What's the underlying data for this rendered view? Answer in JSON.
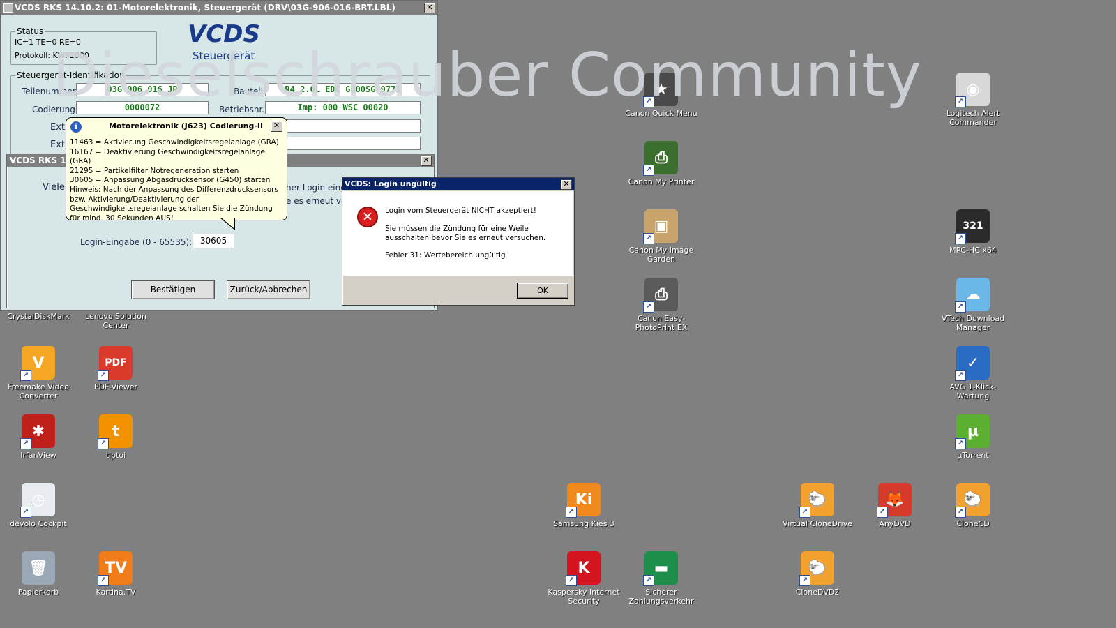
{
  "watermark": "Dieselschrauber Community",
  "main_window": {
    "title": "VCDS RKS 14.10.2: 01-Motorelektronik,  Steuergerät (DRV\\03G-906-016-BRT.LBL)",
    "logo": "VCDS",
    "logo_sub": "Steuergerät",
    "status": {
      "legend": "Status",
      "line1": "IC=1  TE=0   RE=0",
      "line2": "Protokoll: KWP2000"
    },
    "ident": {
      "legend": "Steuergerät-Identifikation",
      "teilenummer_label": "Teilenummer:",
      "teilenummer_value": "03G 906 016 JP",
      "bauteil_label": "Bauteil:",
      "bauteil_value": "R4 2.0L EDC G000SG  9771",
      "codierung_label": "Codierung:",
      "codierung_value": "0000072",
      "betriebsnr_label": "Betriebsnr.:",
      "betriebsnr_value": "Imp: 000     WSC 00020",
      "ext1_label": "Ext",
      "ext2_label": "Ext"
    }
  },
  "sub_window": {
    "title": "VCDS RKS 14.1",
    "text_left": "Viele",
    "text_right1": "her Login eing",
    "text_right2": "e es erneut ve",
    "login_label": "Login-Eingabe (0 - 65535):",
    "login_value": "30605",
    "confirm_button": "Bestätigen",
    "back_button": "Zurück/Abbrechen"
  },
  "tooltip": {
    "title": "Motorelektronik (J623) Codierung-II",
    "lines": [
      "11463 = Aktivierung Geschwindigkeitsregelanlage (GRA)",
      "16167 = Deaktivierung Geschwindigkeitsregelanlage (GRA)",
      "21295 = Partikelfilter Notregeneration starten",
      "30605 = Anpassung Abgasdrucksensor (G450) starten"
    ],
    "hint": "Hinweis: Nach der Anpassung des Differenzdrucksensors bzw. Aktivierung/Deaktivierung der Geschwindigkeitsregelanlage schalten Sie die Zündung für mind. 30 Sekunden AUS!"
  },
  "error_dialog": {
    "title": "VCDS: Login ungültig",
    "line1": "Login vom Steuergerät NICHT akzeptiert!",
    "line2": "Sie müssen die Zündung für eine Weile ausschalten bevor Sie es erneut versuchen.",
    "line3": "Fehler 31: Wertebereich ungültig",
    "ok_button": "OK"
  },
  "desktop_icons": [
    {
      "label": "CrystalDiskMark",
      "glyph": "",
      "color": "#808080"
    },
    {
      "label": "Lenovo Solution Center",
      "glyph": "",
      "color": "#808080"
    },
    {
      "label": "Freemake Video Converter",
      "glyph": "V",
      "color": "#f5a623"
    },
    {
      "label": "PDF-Viewer",
      "glyph": "PDF",
      "color": "#d93a2b"
    },
    {
      "label": "IrfanView",
      "glyph": "✱",
      "color": "#c0201a"
    },
    {
      "label": "tiptoi",
      "glyph": "t",
      "color": "#f39200"
    },
    {
      "label": "devolo Cockpit",
      "glyph": "◷",
      "color": "#e8ecf0"
    },
    {
      "label": "Papierkorb",
      "glyph": "🗑",
      "color": "#9aa7b4"
    },
    {
      "label": "Kartina.TV",
      "glyph": "TV",
      "color": "#f07d1a"
    },
    {
      "label": "Canon Quick Menu",
      "glyph": "★",
      "color": "#4a4a4a"
    },
    {
      "label": "Canon My Printer",
      "glyph": "⎙",
      "color": "#3b6e2f"
    },
    {
      "label": "Canon My Image Garden",
      "glyph": "▣",
      "color": "#c9a46a"
    },
    {
      "label": "Canon Easy-PhotoPrint EX",
      "glyph": "⎙",
      "color": "#5a5a5a"
    },
    {
      "label": "Samsung Kies 3",
      "glyph": "Ki",
      "color": "#f08a1c"
    },
    {
      "label": "Kaspersky Internet Security",
      "glyph": "K",
      "color": "#d4141f"
    },
    {
      "label": "Sicherer Zahlungsverkehr",
      "glyph": "▬",
      "color": "#1e8f4a"
    },
    {
      "label": "Virtual CloneDrive",
      "glyph": "🐑",
      "color": "#f2a02e"
    },
    {
      "label": "AnyDVD",
      "glyph": "🦊",
      "color": "#d63a2a"
    },
    {
      "label": "CloneCD",
      "glyph": "🐑",
      "color": "#f2a02e"
    },
    {
      "label": "CloneDVD2",
      "glyph": "🐑",
      "color": "#f2a02e"
    },
    {
      "label": "Logitech Alert Commander",
      "glyph": "◉",
      "color": "#d8d8d8"
    },
    {
      "label": "MPC-HC x64",
      "glyph": "321",
      "color": "#2b2b2b"
    },
    {
      "label": "VTech Download Manager",
      "glyph": "☁",
      "color": "#6ab7e8"
    },
    {
      "label": "AVG 1-Klick-Wartung",
      "glyph": "✓",
      "color": "#2a6bc4"
    },
    {
      "label": "µTorrent",
      "glyph": "µ",
      "color": "#5cb030"
    }
  ]
}
